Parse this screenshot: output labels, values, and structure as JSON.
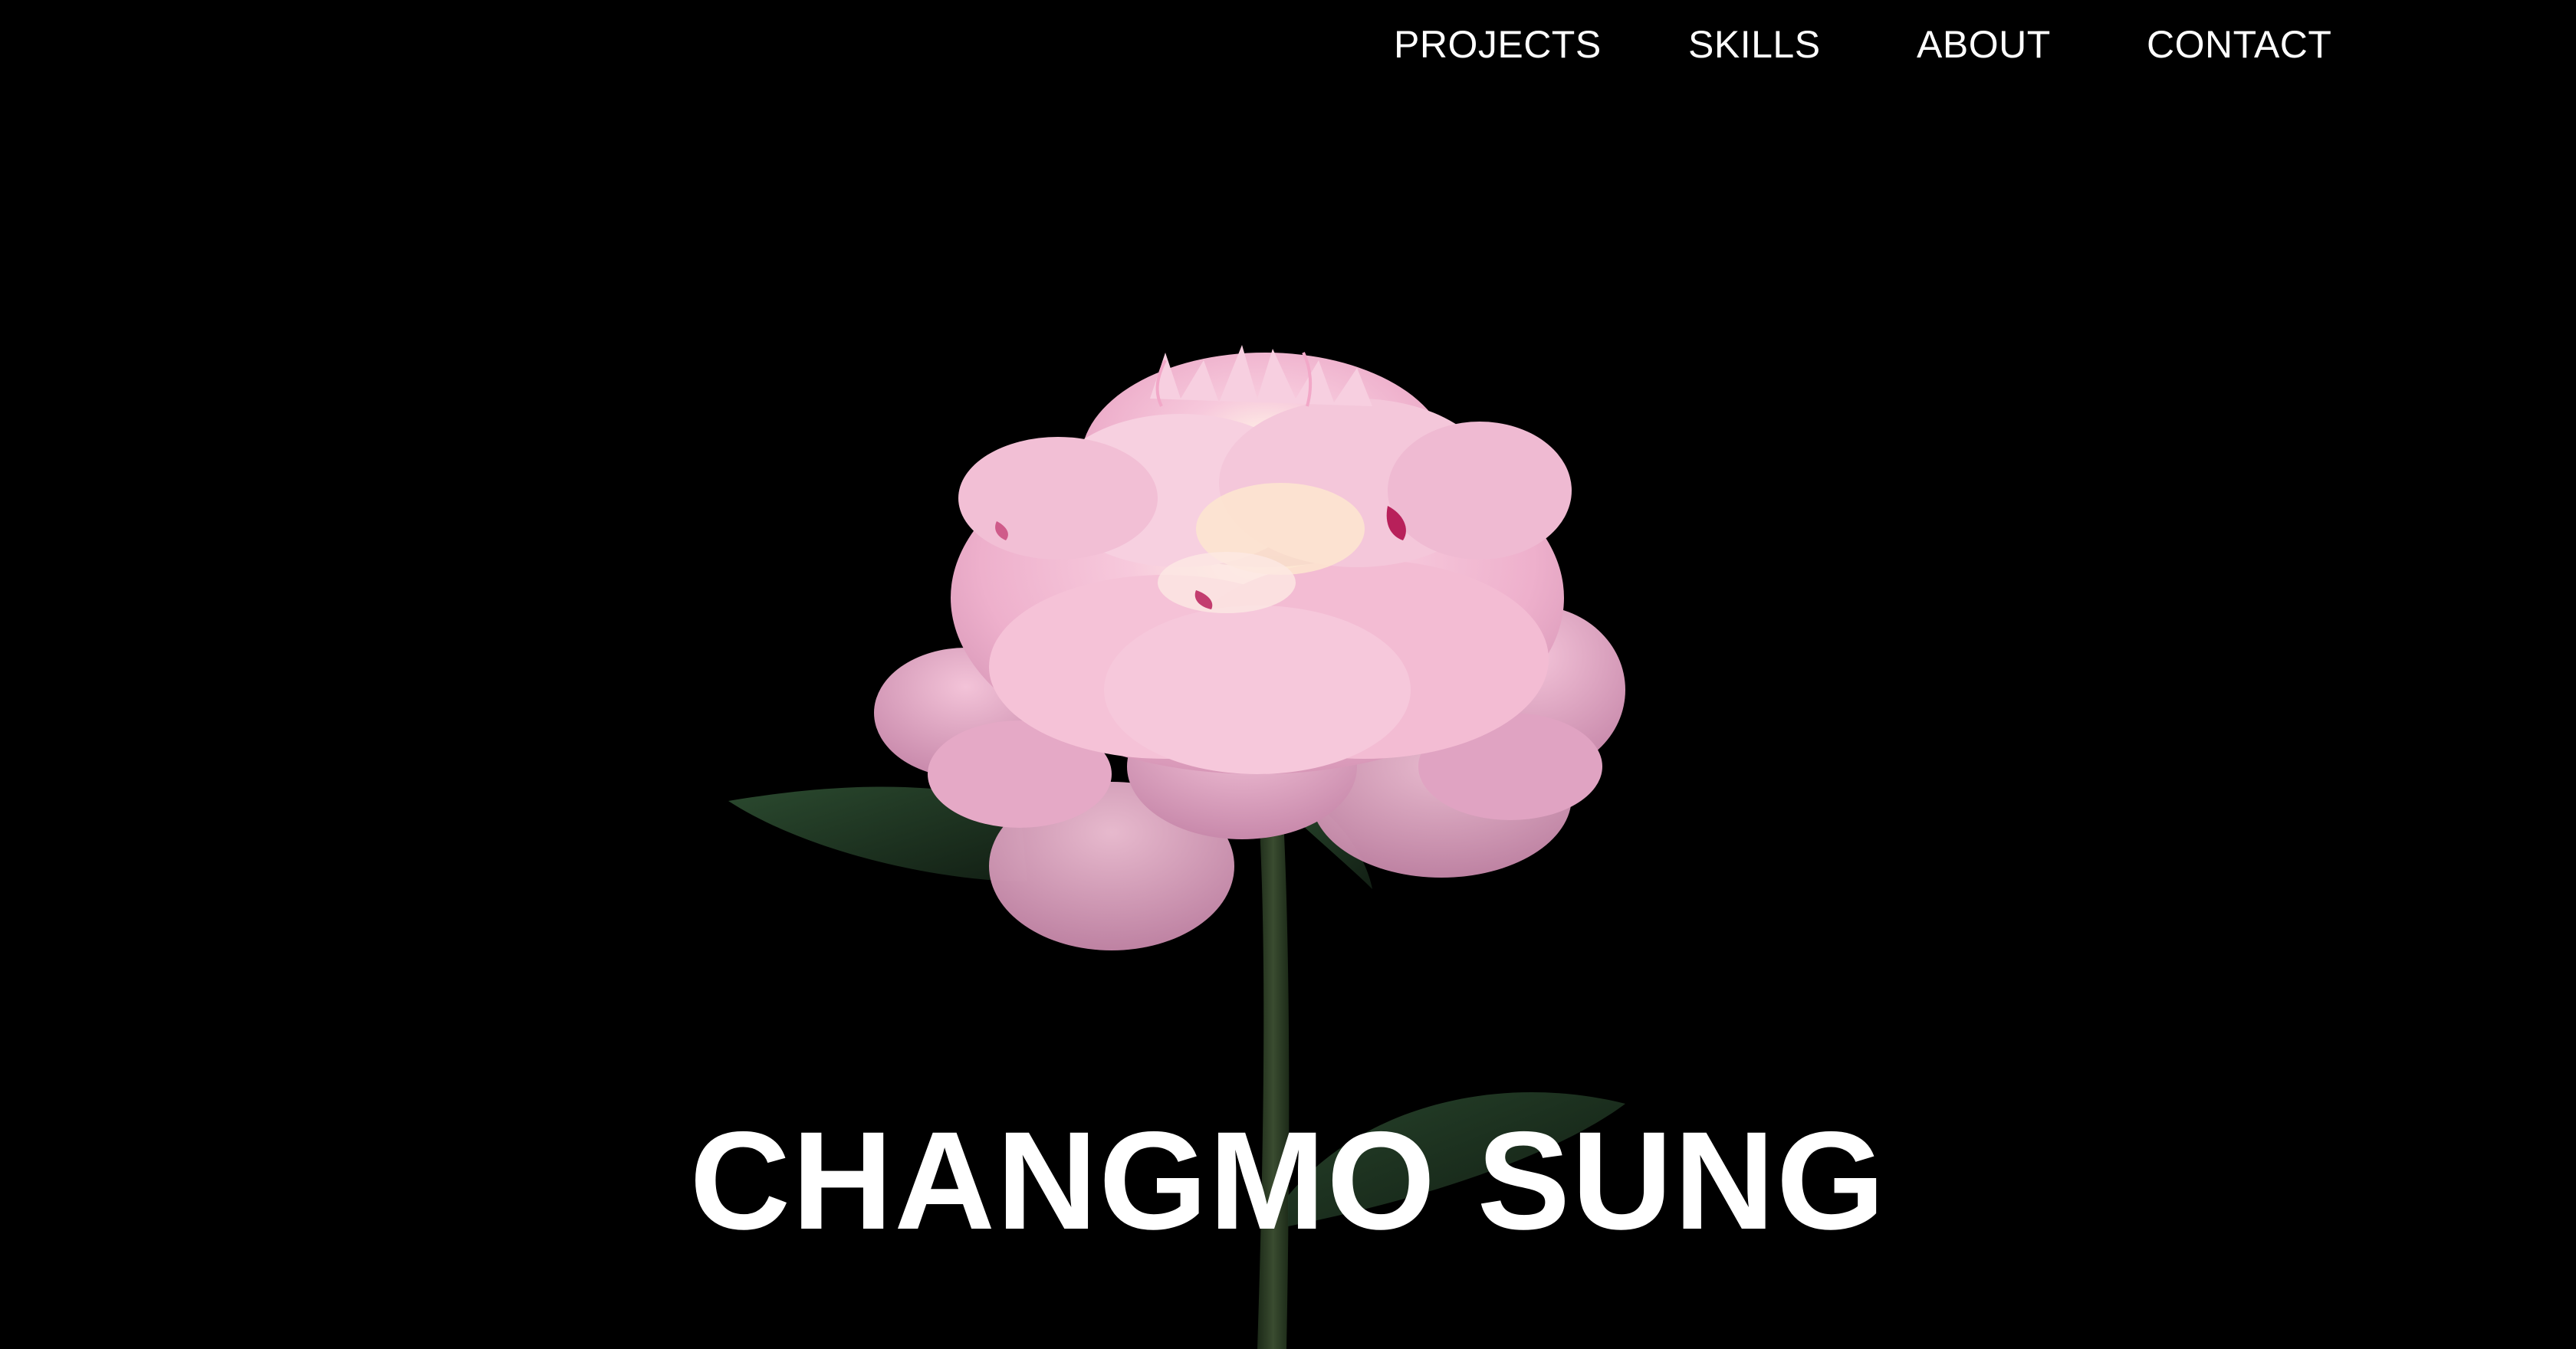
{
  "nav": {
    "items": [
      {
        "label": "PROJECTS"
      },
      {
        "label": "SKILLS"
      },
      {
        "label": "ABOUT"
      },
      {
        "label": "CONTACT"
      }
    ]
  },
  "hero": {
    "title": "CHANGMO SUNG",
    "image": "pink-peony-flower"
  },
  "colors": {
    "background": "#000000",
    "text": "#ffffff",
    "petal": "#f2b8d2",
    "petal_light": "#fde2ec",
    "petal_accent": "#b8205a",
    "leaf": "#1f3522",
    "stem": "#2c3b25"
  }
}
